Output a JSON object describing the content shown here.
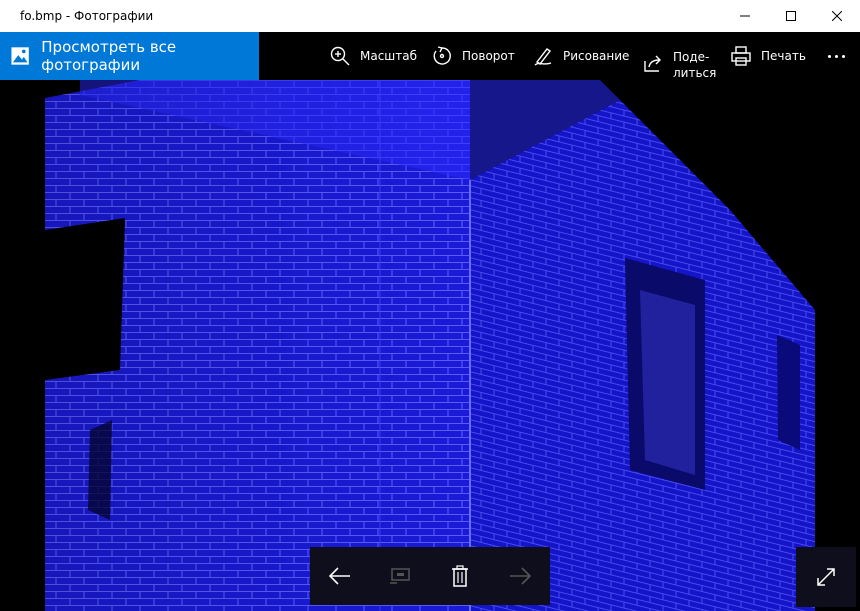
{
  "window": {
    "title": "fo.bmp - Фотографии",
    "controls": [
      "minimize-icon",
      "maximize-icon",
      "close-icon"
    ]
  },
  "toolbar": {
    "view_all_label": "Просмотреть все фотографии",
    "zoom_label": "Масштаб",
    "rotate_label": "Поворот",
    "draw_label": "Рисование",
    "share_label_line1": "Поде-",
    "share_label_line2": "литься",
    "print_label": "Печать",
    "more_icon": "more-icon"
  },
  "colors": {
    "accent": "#0078d7",
    "toolbar_bg": "#000000",
    "titlebar_bg": "#ffffff",
    "photo_tint": "#1010ff"
  },
  "photo": {
    "description_icon": "photo-canvas"
  },
  "navigation": {
    "previous_icon": "arrow-left-icon",
    "slideshow_icon": "slideshow-icon",
    "delete_icon": "trash-icon",
    "next_icon": "arrow-right-icon",
    "fullscreen_icon": "expand-icon"
  }
}
